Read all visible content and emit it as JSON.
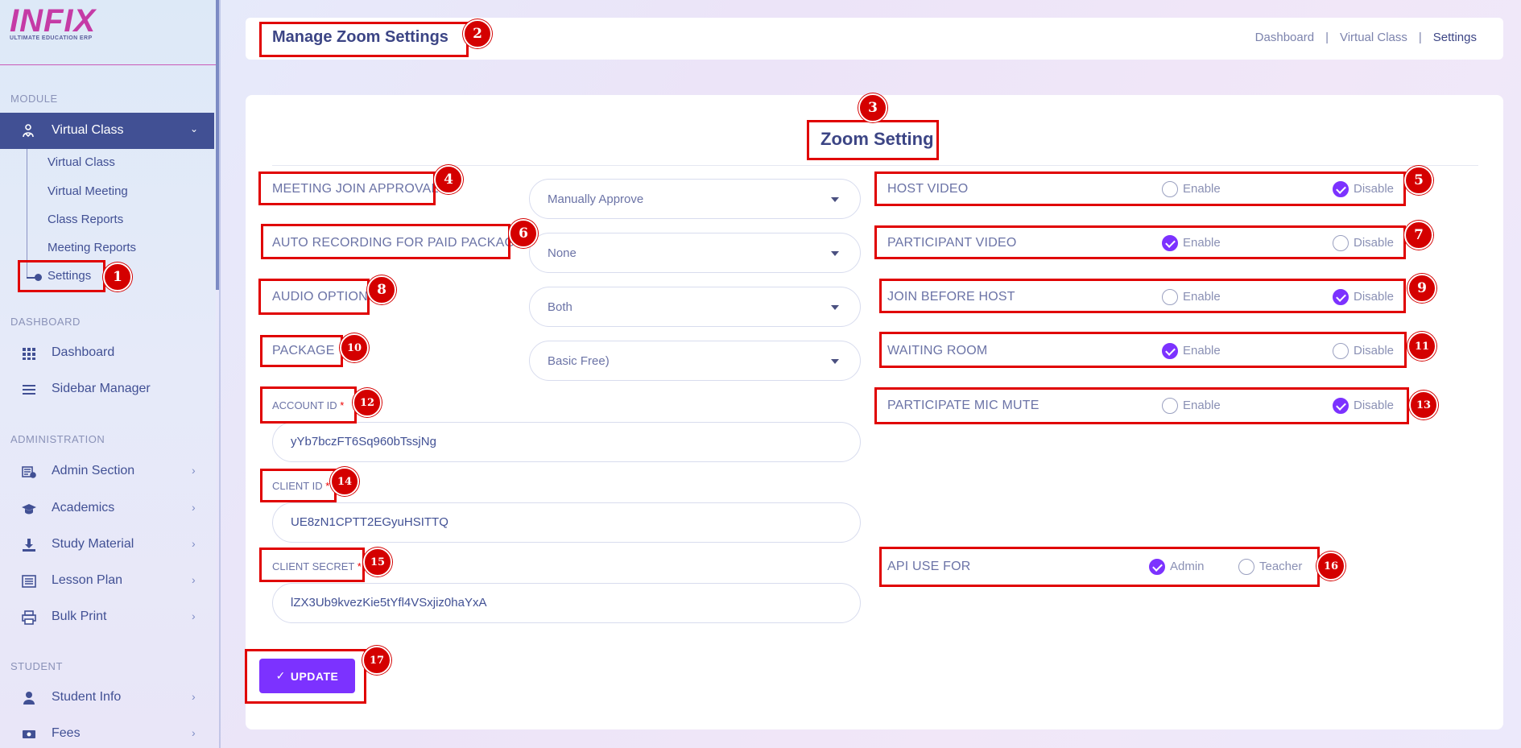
{
  "app": {
    "logo_text": "INFIX",
    "logo_subtext": "ULTIMATE EDUCATION ERP"
  },
  "sidebar": {
    "module_label": "MODULE",
    "active_module": "Virtual Class",
    "sub_items": [
      {
        "label": "Virtual Class"
      },
      {
        "label": "Virtual Meeting"
      },
      {
        "label": "Class Reports"
      },
      {
        "label": "Meeting Reports"
      },
      {
        "label": "Settings"
      }
    ],
    "dashboard_label": "DASHBOARD",
    "dashboard_items": [
      {
        "label": "Dashboard",
        "icon": "grid-icon"
      },
      {
        "label": "Sidebar Manager",
        "icon": "menu-icon"
      }
    ],
    "administration_label": "ADMINISTRATION",
    "admin_items": [
      {
        "label": "Admin Section",
        "icon": "admin-icon"
      },
      {
        "label": "Academics",
        "icon": "graduation-cap-icon"
      },
      {
        "label": "Study Material",
        "icon": "download-icon"
      },
      {
        "label": "Lesson Plan",
        "icon": "list-icon"
      },
      {
        "label": "Bulk Print",
        "icon": "printer-icon"
      }
    ],
    "student_label": "STUDENT",
    "student_items": [
      {
        "label": "Student Info",
        "icon": "user-icon"
      },
      {
        "label": "Fees",
        "icon": "money-icon"
      }
    ]
  },
  "header": {
    "title": "Manage Zoom Settings",
    "breadcrumb": [
      "Dashboard",
      "Virtual Class",
      "Settings"
    ],
    "separator": "|"
  },
  "main": {
    "title": "Zoom Setting",
    "meeting_join_approval": {
      "label": "MEETING JOIN APPROVAL",
      "value": "Manually Approve"
    },
    "auto_recording": {
      "label": "AUTO RECORDING FOR PAID PACKAGE",
      "value": "None"
    },
    "audio_option": {
      "label": "AUDIO OPTION",
      "value": "Both"
    },
    "package": {
      "label": "PACKAGE",
      "value": "Basic Free)"
    },
    "account_id": {
      "label": "ACCOUNT ID",
      "required": "*",
      "value": "yYb7bczFT6Sq960bTssjNg"
    },
    "client_id": {
      "label": "CLIENT ID",
      "required": "*",
      "value": "UE8zN1CPTT2EGyuHSITTQ"
    },
    "client_secret": {
      "label": "CLIENT SECRET",
      "required": "*",
      "value": "lZX3Ub9kvezKie5tYfl4VSxjiz0haYxA"
    },
    "enable_label": "Enable",
    "disable_label": "Disable",
    "host_video": {
      "label": "HOST VIDEO",
      "selected": "Disable"
    },
    "participant_video": {
      "label": "PARTICIPANT VIDEO",
      "selected": "Enable"
    },
    "join_before_host": {
      "label": "JOIN BEFORE HOST",
      "selected": "Disable"
    },
    "waiting_room": {
      "label": "WAITING ROOM",
      "selected": "Enable"
    },
    "participate_mic_mute": {
      "label": "PARTICIPATE MIC MUTE",
      "selected": "Disable"
    },
    "api_use_for": {
      "label": "API USE FOR",
      "options": [
        "Admin",
        "Teacher"
      ],
      "selected": "Admin"
    },
    "update_button": "UPDATE"
  },
  "annotations": [
    "1",
    "2",
    "3",
    "4",
    "5",
    "6",
    "7",
    "8",
    "9",
    "10",
    "11",
    "12",
    "13",
    "14",
    "15",
    "16",
    "17"
  ],
  "colors": {
    "accent": "#7c32ff",
    "primary": "#415094",
    "annotation": "#e00000"
  }
}
